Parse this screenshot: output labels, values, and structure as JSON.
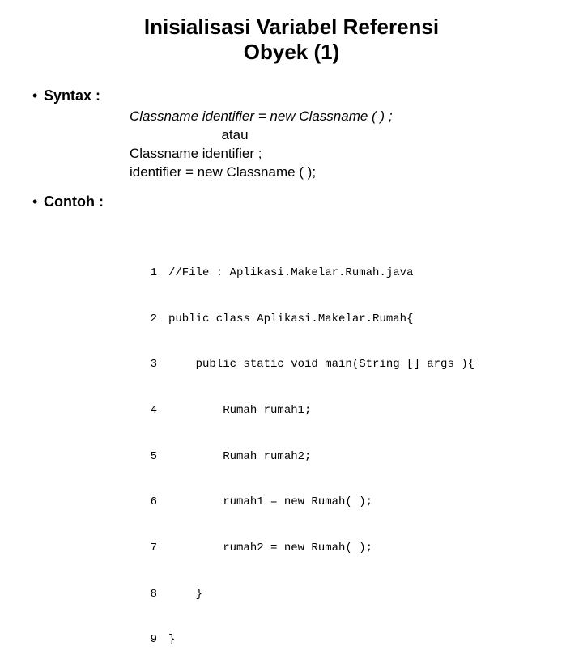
{
  "title_line1": "Inisialisasi Variabel Referensi",
  "title_line2": "Obyek (1)",
  "bullets": {
    "syntax_label": "Syntax :",
    "contoh_label": "Contoh :"
  },
  "syntax": {
    "line1": "Classname identifier = new Classname ( ) ;",
    "atau": "atau",
    "line3": "Classname identifier ;",
    "line4": "identifier = new Classname ( );"
  },
  "code": [
    {
      "n": "1",
      "t": "//File : Aplikasi.Makelar.Rumah.java"
    },
    {
      "n": "2",
      "t": "public class Aplikasi.Makelar.Rumah{"
    },
    {
      "n": "3",
      "t": "    public static void main(String [] args ){"
    },
    {
      "n": "4",
      "t": "        Rumah rumah1;"
    },
    {
      "n": "5",
      "t": "        Rumah rumah2;"
    },
    {
      "n": "6",
      "t": "        rumah1 = new Rumah( );"
    },
    {
      "n": "7",
      "t": "        rumah2 = new Rumah( );"
    },
    {
      "n": "8",
      "t": "    }"
    },
    {
      "n": "9",
      "t": "}"
    }
  ]
}
